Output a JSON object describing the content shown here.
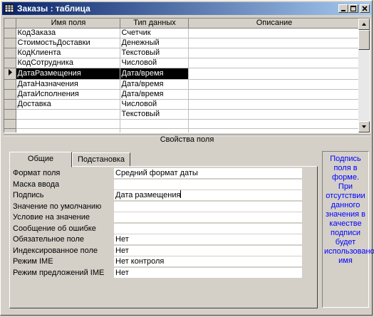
{
  "window": {
    "title": "Заказы : таблица"
  },
  "grid": {
    "headers": [
      "Имя поля",
      "Тип данных",
      "Описание"
    ],
    "rows": [
      {
        "name": "КодЗаказа",
        "type": "Счетчик",
        "desc": ""
      },
      {
        "name": "СтоимостьДоставки",
        "type": "Денежный",
        "desc": ""
      },
      {
        "name": "КодКлиента",
        "type": "Текстовый",
        "desc": ""
      },
      {
        "name": "КодСотрудника",
        "type": "Числовой",
        "desc": ""
      },
      {
        "name": "ДатаРазмещения",
        "type": "Дата/время",
        "desc": ""
      },
      {
        "name": "ДатаНазначения",
        "type": "Дата/время",
        "desc": ""
      },
      {
        "name": "ДатаИсполнения",
        "type": "Дата/время",
        "desc": ""
      },
      {
        "name": "Доставка",
        "type": "Числовой",
        "desc": ""
      },
      {
        "name": "",
        "type": "Текстовый",
        "desc": ""
      },
      {
        "name": "",
        "type": "",
        "desc": ""
      },
      {
        "name": "",
        "type": "",
        "desc": ""
      }
    ],
    "active_row_index": 4
  },
  "properties": {
    "section_label": "Свойства поля",
    "tabs": [
      "Общие",
      "Подстановка"
    ],
    "items": [
      {
        "label": "Формат поля",
        "value": "Средний формат даты"
      },
      {
        "label": "Маска ввода",
        "value": ""
      },
      {
        "label": "Подпись",
        "value": "Дата размещения"
      },
      {
        "label": "Значение по умолчанию",
        "value": ""
      },
      {
        "label": "Условие на значение",
        "value": ""
      },
      {
        "label": "Сообщение об ошибке",
        "value": ""
      },
      {
        "label": "Обязательное поле",
        "value": "Нет"
      },
      {
        "label": "Индексированное поле",
        "value": "Нет"
      },
      {
        "label": "Режим IME",
        "value": "Нет контроля"
      },
      {
        "label": "Режим предложений IME",
        "value": "Нет"
      }
    ],
    "help_text": "Подпись поля в форме. При отсутствии данного значения в качестве подписи будет использовано имя"
  }
}
